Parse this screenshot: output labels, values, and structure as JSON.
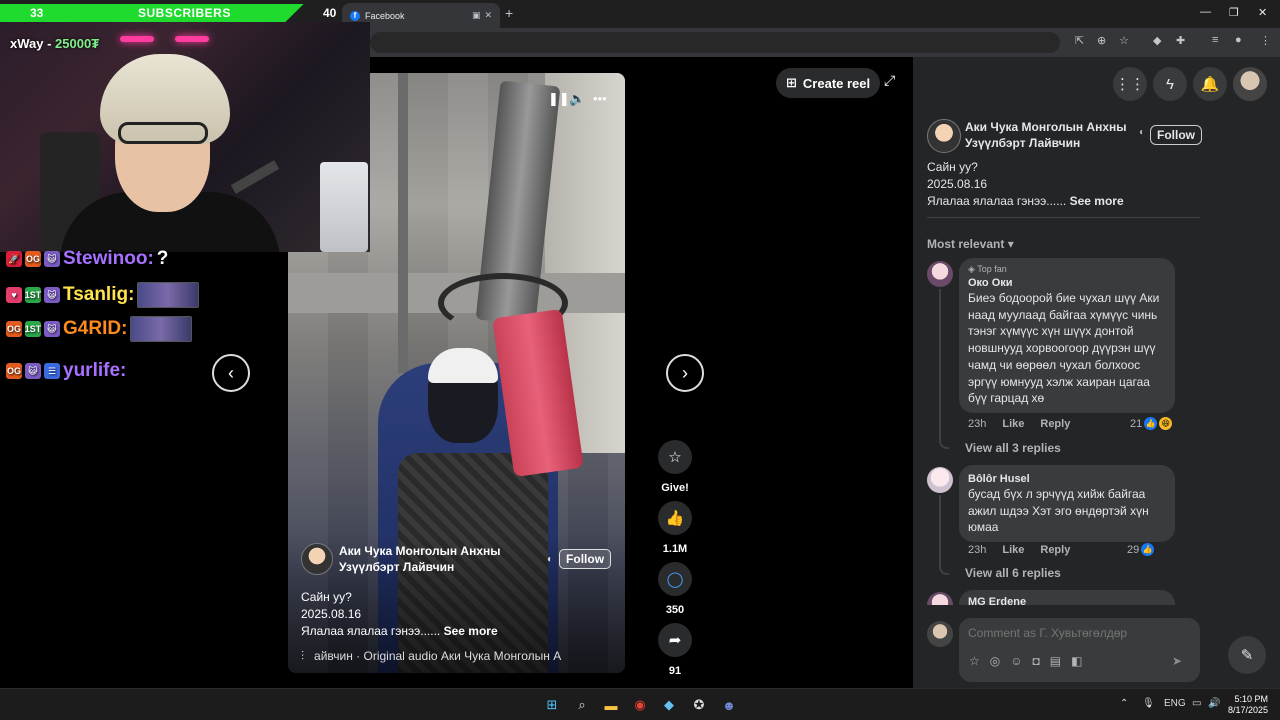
{
  "browser": {
    "tab_title": "Facebook",
    "new_tab": "+"
  },
  "overlay": {
    "sub_left": "33",
    "sub_label": "SUBSCRIBERS",
    "sub_right": "40",
    "sub_progress": 0.88,
    "points_user": "xWay",
    "points_sep": " - ",
    "points_value": "25000₮",
    "chat": [
      {
        "user": "Stewinoo:",
        "message": "?",
        "color": "#a770ff",
        "badges": [
          "#d8203c",
          "#e35b1e",
          "#7a5cc4"
        ]
      },
      {
        "user": "Tsanlig:",
        "message": "",
        "color": "#ffe34d",
        "badges": [
          "#e33d6a",
          "#2aa84a",
          "#7a5cc4"
        ],
        "emote": true
      },
      {
        "user": "G4RID:",
        "message": "",
        "color": "#ff8a1e",
        "badges": [
          "#e35b1e",
          "#2aa84a",
          "#7a5cc4"
        ],
        "emote": true
      },
      {
        "user": "yurlife:",
        "message": "",
        "color": "#a770ff",
        "badges": [
          "#e35b1e",
          "#7a5cc4",
          "#3a6ae0"
        ]
      }
    ]
  },
  "reel": {
    "author_line1": "Аки Чука Монголын Анхны",
    "author_line2": "Узүүлбэрт Лайвчин",
    "follow": "Follow",
    "caption_line1": "Сайн уу?",
    "caption_line2": "2025.08.16",
    "caption_line3": "Ялалаа ялалаа гэнээ......",
    "see_more": "See more",
    "audio": "айвчин · Original audio       Аки Чука Монголын А",
    "create_reel": "Create reel",
    "actions": [
      {
        "icon": "☆",
        "label": "Give!",
        "name": "give-star-icon"
      },
      {
        "icon": "👍",
        "label": "1.1M",
        "name": "like-icon"
      },
      {
        "icon": "◯",
        "label": "350",
        "name": "comment-icon"
      },
      {
        "icon": "➦",
        "label": "91",
        "name": "share-icon"
      }
    ]
  },
  "panel": {
    "author_line1": "Аки Чука Монголын Анхны",
    "author_line2": "Узүүлбэрт Лайвчин",
    "follow": "Follow",
    "caption_line1": "Сайн уу?",
    "caption_line2": "2025.08.16",
    "caption_line3": "Ялалаа ялалаа гэнээ......",
    "see_more": "See more",
    "sort": "Most relevant",
    "comments": [
      {
        "badge": "Top fan",
        "name": "Око Оки",
        "text": "Биеэ бодоорой бие чухал шүү Аки наад муулаад байгаа хүмүүс чинь тэнэг хүмүүс хүн шүүх донтой новшнууд хорвоогоор дүүрэн шүү чамд чи өөрөөл чухал болхоос эргүү юмнууд хэлж хаиран цагаа бүү гарцад хө",
        "time": "23h",
        "like": "Like",
        "reply": "Reply",
        "reactions": "21",
        "view_replies": "View all 3 replies"
      },
      {
        "name": "Bôlôr Husel",
        "text": "бусад бүх л эрчүүд хийж байгаа ажил шдээ Хэт эго өндөртэй хүн юмаа",
        "time": "23h",
        "like": "Like",
        "reply": "Reply",
        "reactions": "29",
        "view_replies": "View all 6 replies"
      },
      {
        "name": "MG Erdene"
      }
    ],
    "comment_placeholder": "Comment as Г. Хувьтөгөлдөр"
  },
  "taskbar": {
    "lang": "ENG",
    "time": "5:10 PM",
    "date": "8/17/2025"
  }
}
